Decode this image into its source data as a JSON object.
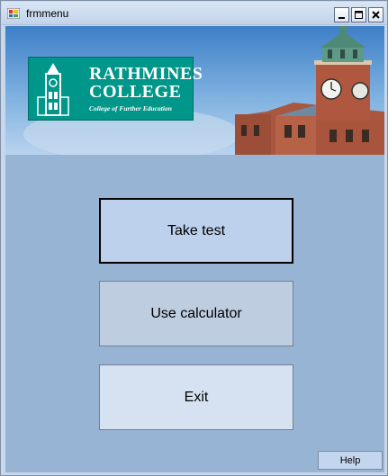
{
  "window": {
    "title": "frmmenu",
    "controls": {
      "minimize": "minimize",
      "maximize": "maximize",
      "close": "close"
    }
  },
  "banner": {
    "logo": {
      "line1": "RATHMINES",
      "line2": "COLLEGE",
      "tagline": "College of Further Education"
    }
  },
  "menu": {
    "take_test_label": "Take test",
    "use_calculator_label": "Use calculator",
    "exit_label": "Exit"
  },
  "help_label": "Help",
  "colors": {
    "client_bg": "#98b4d4",
    "logo_bg": "#00968a",
    "sky_top": "#3d7fc7",
    "brick": "#a9573f"
  }
}
